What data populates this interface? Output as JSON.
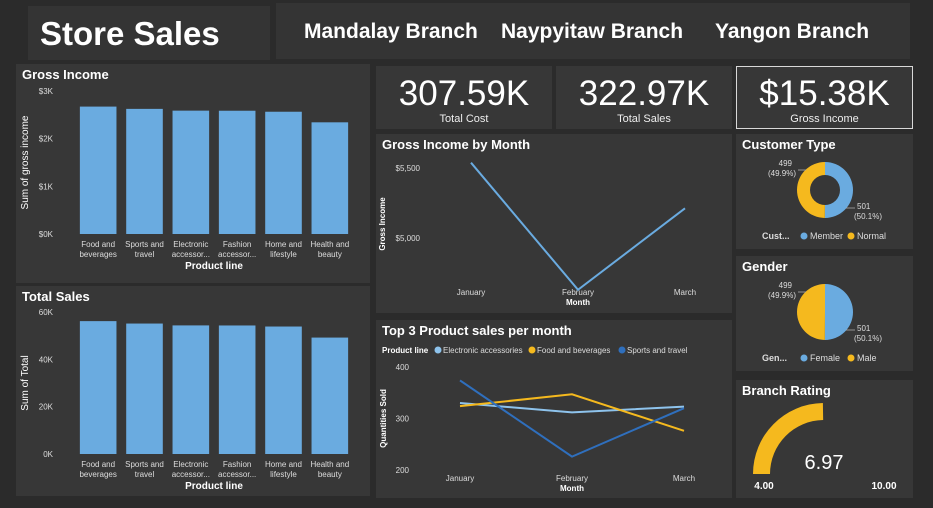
{
  "header": {
    "title": "Store Sales",
    "branches": [
      "Mandalay Branch",
      "Naypyitaw Branch",
      "Yangon Branch"
    ]
  },
  "kpis": [
    {
      "value": "307.59K",
      "label": "Total Cost"
    },
    {
      "value": "322.97K",
      "label": "Total Sales"
    },
    {
      "value": "$15.38K",
      "label": "Gross Income"
    }
  ],
  "colors": {
    "bar": "#6aabe0",
    "accent": "#f5b91e",
    "blue": "#6aabe0",
    "dark_blue": "#2f6fbd"
  },
  "chart_data": [
    {
      "id": "gross_income",
      "type": "bar",
      "title": "Gross Income",
      "xlabel": "Product line",
      "ylabel": "Sum of gross income",
      "categories": [
        "Food and beverages",
        "Sports and travel",
        "Electronic accessories",
        "Fashion accessories",
        "Home and lifestyle",
        "Health and beauty"
      ],
      "category_labels": [
        [
          "Food and",
          "beverages"
        ],
        [
          "Sports and",
          "travel"
        ],
        [
          "Electronic",
          "accessor..."
        ],
        [
          "Fashion",
          "accessor..."
        ],
        [
          "Home and",
          "lifestyle"
        ],
        [
          "Health and",
          "beauty"
        ]
      ],
      "values": [
        2673,
        2625,
        2588,
        2586,
        2565,
        2343
      ],
      "ylim": [
        0,
        3000
      ],
      "yticks": [
        0,
        1000,
        2000,
        3000
      ],
      "ytick_labels": [
        "$0K",
        "$1K",
        "$2K",
        "$3K"
      ]
    },
    {
      "id": "total_sales",
      "type": "bar",
      "title": "Total Sales",
      "xlabel": "Product line",
      "ylabel": "Sum of Total",
      "categories": [
        "Food and beverages",
        "Sports and travel",
        "Electronic accessories",
        "Fashion accessories",
        "Home and lifestyle",
        "Health and beauty"
      ],
      "category_labels": [
        [
          "Food and",
          "beverages"
        ],
        [
          "Sports and",
          "travel"
        ],
        [
          "Electronic",
          "accessor..."
        ],
        [
          "Fashion",
          "accessor..."
        ],
        [
          "Home and",
          "lifestyle"
        ],
        [
          "Health and",
          "beauty"
        ]
      ],
      "values": [
        56145,
        55123,
        54338,
        54306,
        53862,
        49193
      ],
      "ylim": [
        0,
        60000
      ],
      "yticks": [
        0,
        20000,
        40000,
        60000
      ],
      "ytick_labels": [
        "0K",
        "20K",
        "40K",
        "60K"
      ]
    },
    {
      "id": "gross_by_month",
      "type": "line",
      "title": "Gross Income by Month",
      "xlabel": "Month",
      "ylabel": "Gross Income",
      "x": [
        "January",
        "February",
        "March"
      ],
      "values": [
        5538,
        4630,
        5212
      ],
      "ylim": [
        4600,
        5600
      ],
      "yticks": [
        5000,
        5500
      ],
      "ytick_labels": [
        "$5,000",
        "$5,500"
      ]
    },
    {
      "id": "top3_products",
      "type": "line",
      "title": "Top 3 Product sales per month",
      "legend_title": "Product line",
      "xlabel": "Month",
      "ylabel": "Quantities Sold",
      "x": [
        "January",
        "February",
        "March"
      ],
      "ylim": [
        200,
        400
      ],
      "yticks": [
        200,
        300,
        400
      ],
      "ytick_labels": [
        "200",
        "300",
        "400"
      ],
      "series": [
        {
          "name": "Electronic accessories",
          "color": "#8ec3ec",
          "values": [
            330,
            312,
            323
          ]
        },
        {
          "name": "Food and beverages",
          "color": "#f5b91e",
          "values": [
            324,
            347,
            276
          ]
        },
        {
          "name": "Sports and travel",
          "color": "#2f6fbd",
          "values": [
            374,
            226,
            320
          ]
        }
      ]
    },
    {
      "id": "customer_type",
      "type": "pie",
      "title": "Customer Type",
      "donut": true,
      "legend_title": "Cust...",
      "slices": [
        {
          "name": "Member",
          "value": 501,
          "label": "501",
          "pct": "(50.1%)",
          "color": "#6aabe0"
        },
        {
          "name": "Normal",
          "value": 499,
          "label": "499",
          "pct": "(49.9%)",
          "color": "#f5b91e"
        }
      ]
    },
    {
      "id": "gender",
      "type": "pie",
      "title": "Gender",
      "donut": false,
      "legend_title": "Gen...",
      "slices": [
        {
          "name": "Female",
          "value": 501,
          "label": "501",
          "pct": "(50.1%)",
          "color": "#6aabe0"
        },
        {
          "name": "Male",
          "value": 499,
          "label": "499",
          "pct": "(49.9%)",
          "color": "#f5b91e"
        }
      ]
    }
  ],
  "gauge": {
    "title": "Branch Rating",
    "value": 6.97,
    "value_label": "6.97",
    "min": 4.0,
    "max": 10.0,
    "min_label": "4.00",
    "max_label": "10.00",
    "color": "#f5b91e"
  }
}
